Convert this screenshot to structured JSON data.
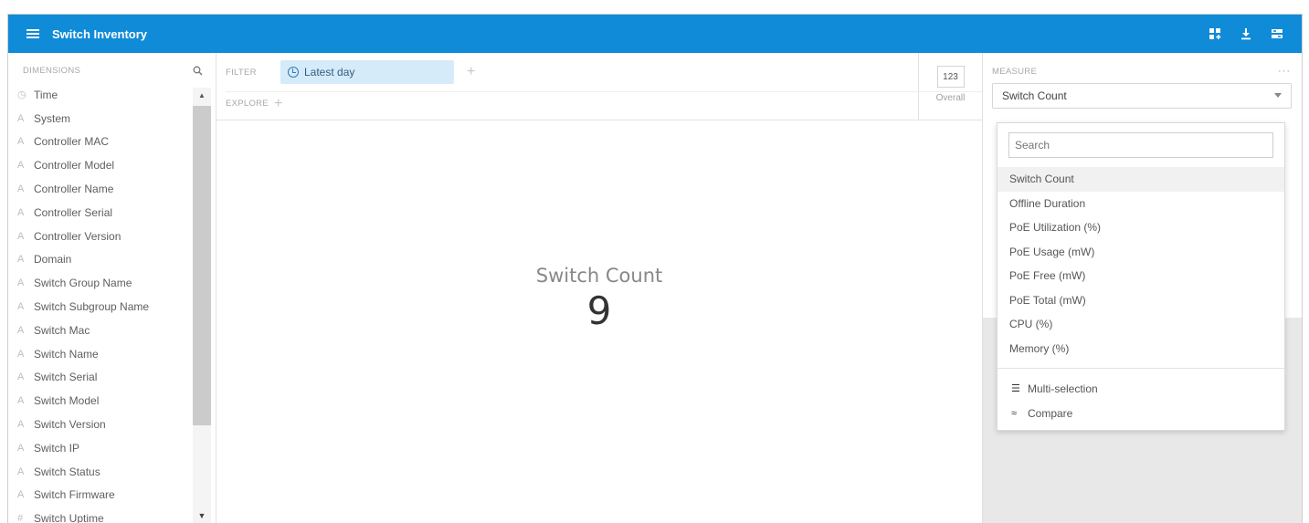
{
  "header": {
    "title": "Switch Inventory"
  },
  "sidebar": {
    "heading": "DIMENSIONS",
    "items": [
      {
        "label": "Time",
        "icon": "clock-icon"
      },
      {
        "label": "System",
        "icon": "string-dimension-icon"
      },
      {
        "label": "Controller MAC",
        "icon": "string-dimension-icon"
      },
      {
        "label": "Controller Model",
        "icon": "string-dimension-icon"
      },
      {
        "label": "Controller Name",
        "icon": "string-dimension-icon"
      },
      {
        "label": "Controller Serial",
        "icon": "string-dimension-icon"
      },
      {
        "label": "Controller Version",
        "icon": "string-dimension-icon"
      },
      {
        "label": "Domain",
        "icon": "string-dimension-icon"
      },
      {
        "label": "Switch Group Name",
        "icon": "string-dimension-icon"
      },
      {
        "label": "Switch Subgroup Name",
        "icon": "string-dimension-icon"
      },
      {
        "label": "Switch Mac",
        "icon": "string-dimension-icon"
      },
      {
        "label": "Switch Name",
        "icon": "string-dimension-icon"
      },
      {
        "label": "Switch Serial",
        "icon": "string-dimension-icon"
      },
      {
        "label": "Switch Model",
        "icon": "string-dimension-icon"
      },
      {
        "label": "Switch Version",
        "icon": "string-dimension-icon"
      },
      {
        "label": "Switch IP",
        "icon": "string-dimension-icon"
      },
      {
        "label": "Switch Status",
        "icon": "string-dimension-icon"
      },
      {
        "label": "Switch Firmware",
        "icon": "string-dimension-icon"
      },
      {
        "label": "Switch Uptime",
        "icon": "numeric-dimension-icon"
      }
    ]
  },
  "filter": {
    "label": "FILTER",
    "pill_label": "Latest day"
  },
  "explore": {
    "label": "EXPLORE"
  },
  "overall": {
    "box": "123",
    "label": "Overall"
  },
  "visualization": {
    "label": "Switch Count",
    "value": "9"
  },
  "measure": {
    "heading": "MEASURE",
    "selected": "Switch Count",
    "search_placeholder": "Search",
    "options": [
      "Switch Count",
      "Offline Duration",
      "PoE Utilization (%)",
      "PoE Usage (mW)",
      "PoE Free (mW)",
      "PoE Total (mW)",
      "CPU (%)",
      "Memory (%)"
    ],
    "actions": [
      {
        "label": "Multi-selection",
        "icon": "list-icon"
      },
      {
        "label": "Compare",
        "icon": "compare-icon"
      }
    ]
  },
  "colors": {
    "header": "#0f8bd8",
    "pill": "#d6ebf9",
    "panel_bg": "#e8e8e8"
  }
}
